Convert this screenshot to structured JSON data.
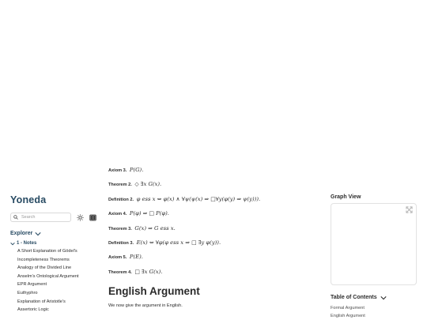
{
  "site": {
    "title": "Yoneda"
  },
  "search": {
    "placeholder": "Search"
  },
  "icons": {
    "search": "search-icon",
    "theme": "sun-icon",
    "reader": "book-icon",
    "explorer": "chevron-down-icon",
    "folder": "chevron-down-icon",
    "graph": "expand-icon",
    "toc": "chevron-down-icon"
  },
  "colors": {
    "brand": "#284b63",
    "text": "#2b2b2b",
    "muted": "#9a9a9a",
    "border": "#e2e2e2"
  },
  "explorer": {
    "label": "Explorer",
    "folder": "1 - Notes",
    "files": [
      "A Short Explanation of Gödel's",
      "Incompleteness Theorems",
      "Analogy of the Divided Line",
      "Anselm's Ontological Argument",
      "EPR Argument",
      "Euthyphro",
      "Explanation of Aristotle's",
      "Assertoric Logic"
    ]
  },
  "content": {
    "statements": [
      {
        "label": "Axiom 3.",
        "math": "P(G)."
      },
      {
        "label": "Theorem 2.",
        "math": "◇ ∃x G(x)."
      },
      {
        "label": "Definition 2.",
        "math": "φ ess x ⇔ φ(x) ∧ ∀ψ(ψ(x) ⇒ □∀y(φ(y) ⇒ ψ(y)))."
      },
      {
        "label": "Axiom 4.",
        "math": "P(φ) ⇒ □ P(φ)."
      },
      {
        "label": "Theorem 3.",
        "math": "G(x) ⇒ G ess x."
      },
      {
        "label": "Definition 3.",
        "math": "E(x) ⇔ ∀φ(φ ess x ⇒ □ ∃y φ(y))."
      },
      {
        "label": "Axiom 5.",
        "math": "P(E)."
      },
      {
        "label": "Theorem 4.",
        "math": "□ ∃x G(x)."
      }
    ],
    "heading": "English Argument",
    "paragraph": "We now give the argument in English."
  },
  "graph": {
    "title": "Graph View"
  },
  "toc": {
    "title": "Table of Contents",
    "items": [
      "Formal Argument",
      "English Argument"
    ]
  }
}
